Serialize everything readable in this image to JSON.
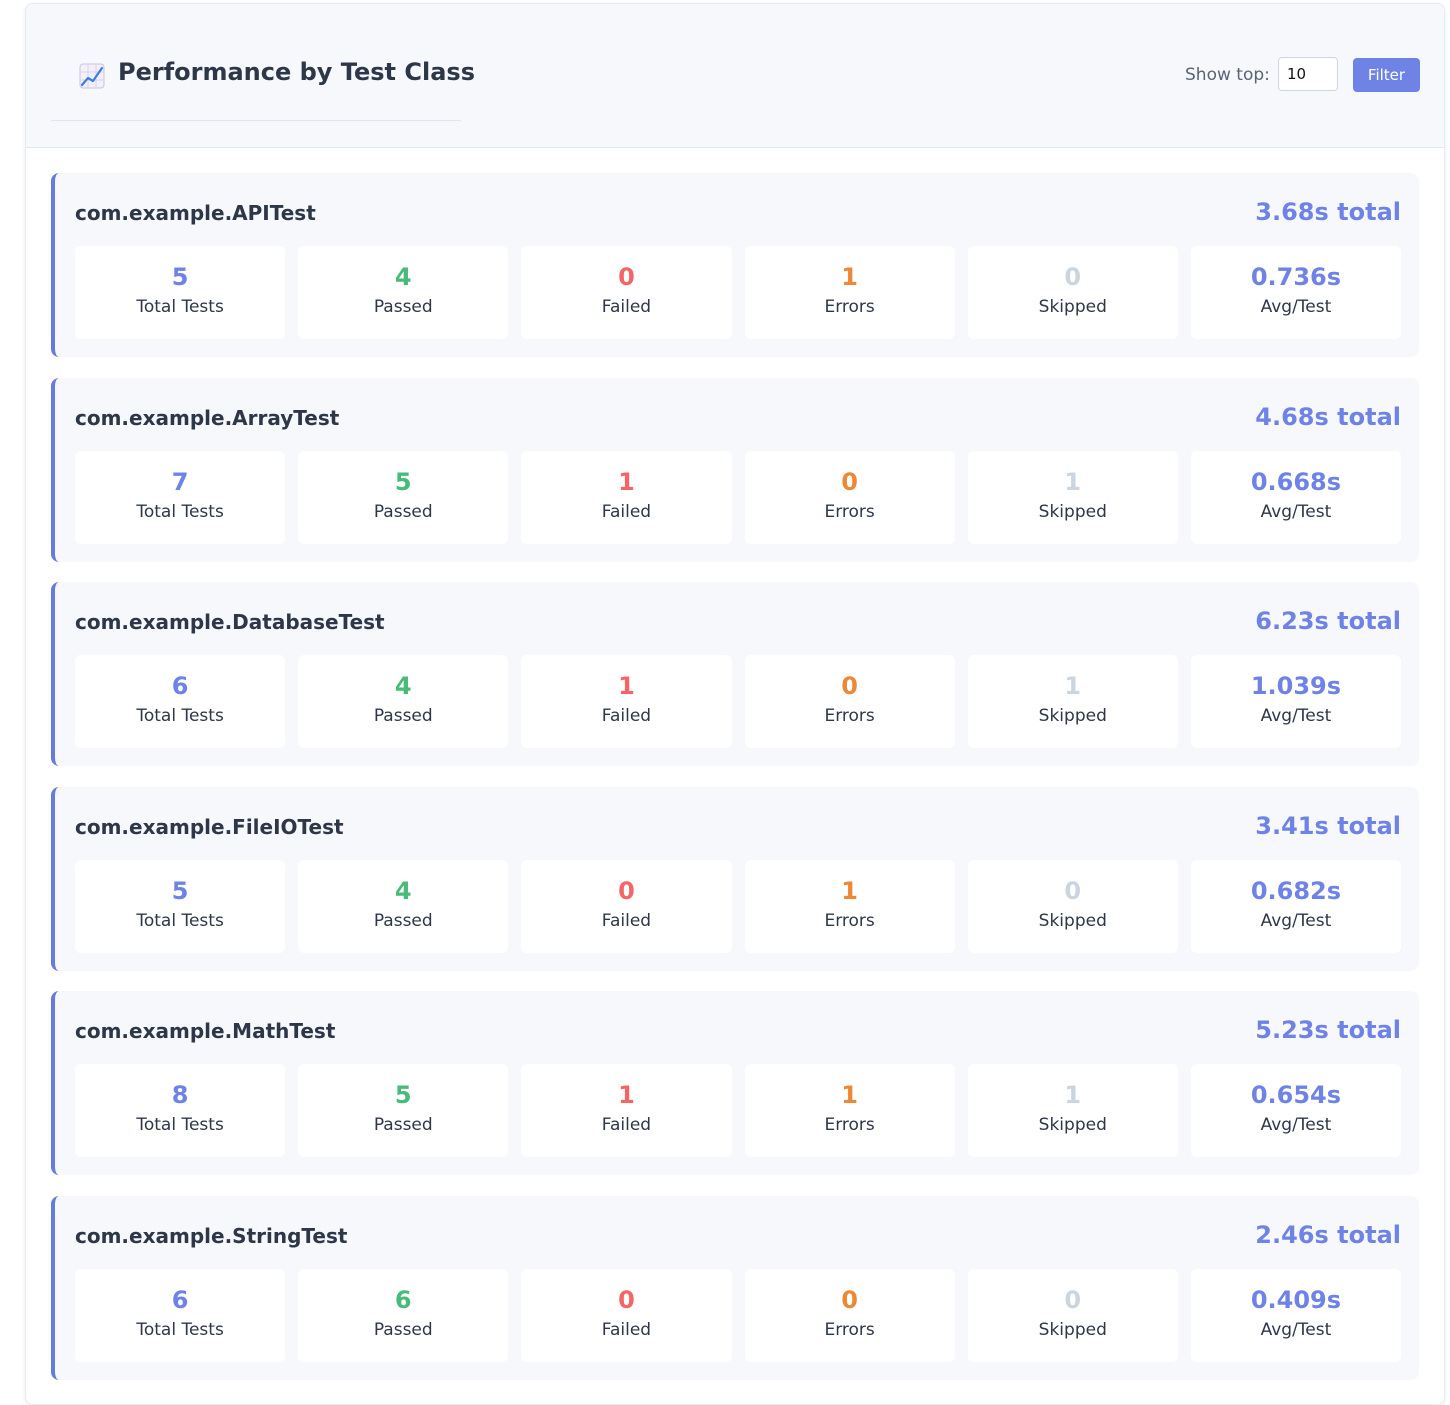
{
  "header": {
    "title": "Performance by Test Class",
    "title_icon": "chart-increasing-icon",
    "filter_label": "Show top:",
    "filter_value": "10",
    "filter_button": "Filter"
  },
  "stat_labels": {
    "total": "Total Tests",
    "passed": "Passed",
    "failed": "Failed",
    "errors": "Errors",
    "skipped": "Skipped",
    "avg": "Avg/Test"
  },
  "colors": {
    "accent": "#6f83e6",
    "passed": "#48bb78",
    "failed": "#f56565",
    "errors": "#ed8936",
    "skipped": "#cbd5e0"
  },
  "classes": [
    {
      "name": "com.example.APITest",
      "total_time": "3.68s total",
      "total": "5",
      "passed": "4",
      "failed": "0",
      "errors": "1",
      "skipped": "0",
      "avg": "0.736s"
    },
    {
      "name": "com.example.ArrayTest",
      "total_time": "4.68s total",
      "total": "7",
      "passed": "5",
      "failed": "1",
      "errors": "0",
      "skipped": "1",
      "avg": "0.668s"
    },
    {
      "name": "com.example.DatabaseTest",
      "total_time": "6.23s total",
      "total": "6",
      "passed": "4",
      "failed": "1",
      "errors": "0",
      "skipped": "1",
      "avg": "1.039s"
    },
    {
      "name": "com.example.FileIOTest",
      "total_time": "3.41s total",
      "total": "5",
      "passed": "4",
      "failed": "0",
      "errors": "1",
      "skipped": "0",
      "avg": "0.682s"
    },
    {
      "name": "com.example.MathTest",
      "total_time": "5.23s total",
      "total": "8",
      "passed": "5",
      "failed": "1",
      "errors": "1",
      "skipped": "1",
      "avg": "0.654s"
    },
    {
      "name": "com.example.StringTest",
      "total_time": "2.46s total",
      "total": "6",
      "passed": "6",
      "failed": "0",
      "errors": "0",
      "skipped": "0",
      "avg": "0.409s"
    }
  ]
}
